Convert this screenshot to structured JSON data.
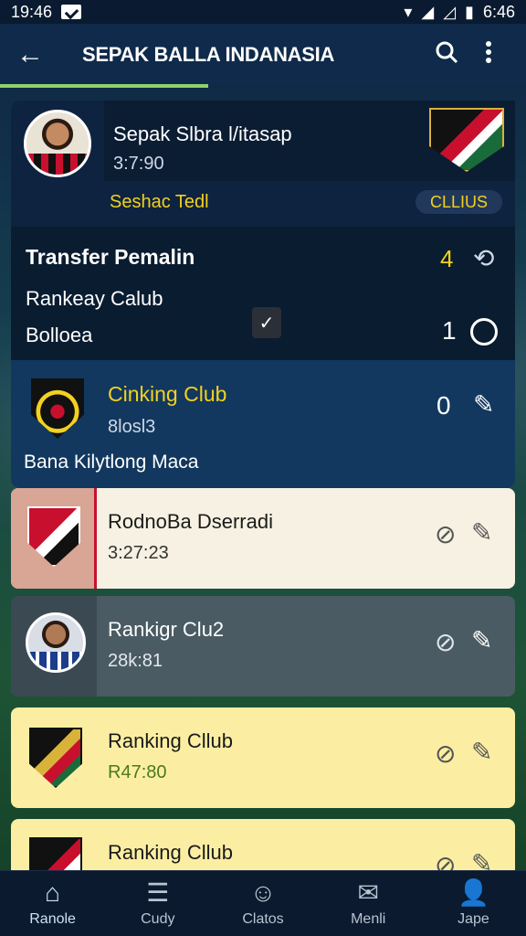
{
  "status_bar": {
    "time_left": "19:46",
    "time_right": "6:46"
  },
  "app_bar": {
    "title": "SEPAK BALLA INDANASIA",
    "back_icon": "back-arrow-icon",
    "search_icon": "search-icon",
    "menu_icon": "more-vert-icon"
  },
  "profile_card": {
    "name": "Sepak Slbra l/itasap",
    "time": "3:7:90",
    "tag": "Seshac Tedl",
    "badge": "CLLIUS"
  },
  "transfer": {
    "title": "Transfer Pemalin",
    "count": "4",
    "line1": "Rankeay Calub",
    "line2": "Bolloea",
    "value": "1"
  },
  "cinking": {
    "title": "Cinking Club",
    "sub": "8losl3",
    "value": "0",
    "footer": "Bana Kilytlong Maca"
  },
  "list": [
    {
      "title": "RodnoBa Dserradi",
      "sub": "3:27:23",
      "theme": "cream"
    },
    {
      "title": "Rankigr Clu2",
      "sub": "28k:81",
      "theme": "slate"
    },
    {
      "title": "Ranking Cllub",
      "sub": "R47:80",
      "theme": "yellow"
    },
    {
      "title": "Ranking Cllub",
      "sub": "",
      "theme": "yellow"
    }
  ],
  "bottom_nav": [
    {
      "label": "Ranole",
      "icon": "home-icon"
    },
    {
      "label": "Cudy",
      "icon": "list-icon"
    },
    {
      "label": "Clatos",
      "icon": "chat-icon"
    },
    {
      "label": "Menli",
      "icon": "mail-icon"
    },
    {
      "label": "Jape",
      "icon": "profile-icon"
    }
  ]
}
